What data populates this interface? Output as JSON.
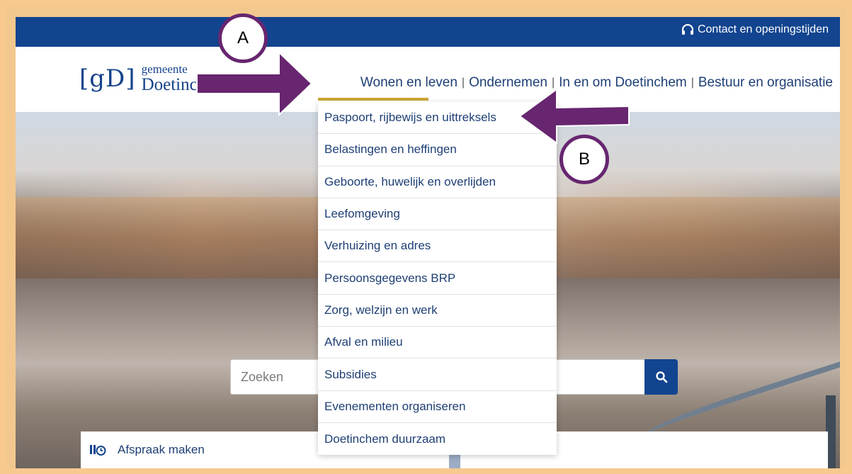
{
  "topbar": {
    "contact_label": "Contact en openingstijden",
    "icon": "headset-icon"
  },
  "logo": {
    "mark": "[gD]",
    "line1": "gemeente",
    "line2": "Doetinchem"
  },
  "nav": {
    "items": [
      "Wonen en leven",
      "Ondernemen",
      "In en om Doetinchem",
      "Bestuur en organisatie"
    ],
    "separator": "|",
    "active": "Wonen en leven"
  },
  "dropdown": {
    "items": [
      "Paspoort, rijbewijs en uittreksels",
      "Belastingen en heffingen",
      "Geboorte, huwelijk en overlijden",
      "Leefomgeving",
      "Verhuizing en adres",
      "Persoonsgegevens BRP",
      "Zorg, welzijn en werk",
      "Afval en milieu",
      "Subsidies",
      "Evenementen organiseren",
      "Doetinchem duurzaam"
    ]
  },
  "search": {
    "placeholder": "Zoeken",
    "icon": "search-icon"
  },
  "quicklinks": {
    "appointment_label": "Afspraak maken",
    "icon": "calendar-clock-icon"
  },
  "annotations": {
    "a_label": "A",
    "b_label": "B"
  },
  "colors": {
    "brand_blue": "#12448f",
    "nav_text": "#1e3f74",
    "active_underline": "#c9a733",
    "annotation_purple": "#67266f",
    "frame": "#f3c88e"
  }
}
